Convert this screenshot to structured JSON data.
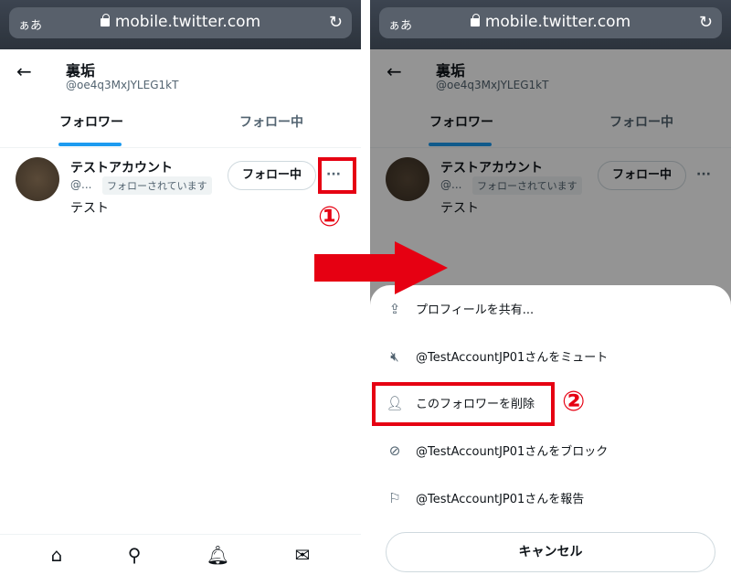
{
  "browser": {
    "text_size": "ぁあ",
    "url": "mobile.twitter.com",
    "reload_icon": "reload-icon",
    "lock_icon": "lock-icon"
  },
  "profile": {
    "name": "裏垢",
    "handle": "@oe4q3MxJYLEG1kT"
  },
  "tabs": [
    {
      "label": "フォロワー",
      "active": true
    },
    {
      "label": "フォロー中",
      "active": false
    }
  ],
  "accent": "#1d9bf0",
  "user": {
    "name": "テストアカウント",
    "handle": "@...",
    "badge": "フォローされています",
    "bio": "テスト",
    "follow_button": "フォロー中",
    "more": "···"
  },
  "bottom_nav": [
    "home-icon",
    "search-icon",
    "bell-icon",
    "mail-icon"
  ],
  "menu": {
    "items": [
      {
        "icon": "share-icon",
        "label": "プロフィールを共有..."
      },
      {
        "icon": "mute-icon",
        "label": "@TestAccountJP01さんをミュート"
      },
      {
        "icon": "remove-user-icon",
        "label": "このフォロワーを削除"
      },
      {
        "icon": "block-icon",
        "label": "@TestAccountJP01さんをブロック"
      },
      {
        "icon": "flag-icon",
        "label": "@TestAccountJP01さんを報告"
      }
    ],
    "cancel": "キャンセル"
  },
  "annotations": {
    "step1": "①",
    "step2": "②",
    "color": "#e60012"
  }
}
